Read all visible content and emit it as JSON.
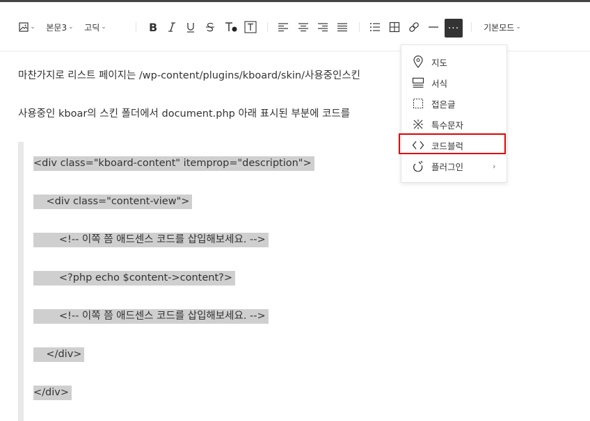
{
  "toolbar": {
    "text_style": "본문3",
    "font": "고딕",
    "mode": "기본모드",
    "more_label": "···",
    "buttons": [
      "image",
      "bold",
      "italic",
      "underline",
      "strikethrough",
      "text-color",
      "text-background",
      "align-left",
      "align-center",
      "align-right",
      "align-justify",
      "bullet-list",
      "table",
      "link",
      "horizontal-line",
      "more"
    ]
  },
  "content": {
    "para1": "마찬가지로 리스트 페이지는 /wp-content/plugins/kboard/skin/사용중인스킨",
    "para2": "사용중인 kboar의 스킨 폴더에서 document.php 아래 표시된 부분에 코드를",
    "code_lines": [
      "<div class=\"kboard-content\" itemprop=\"description\">",
      "    <div class=\"content-view\">",
      "        <!-- 이쪽 쯤 애드센스 코드를 삽입해보세요. -->",
      "        <?php echo $content->content?>",
      "        <!-- 이쪽 쯤 애드센스 코드를 삽입해보세요. -->",
      "    </div>",
      "</div>"
    ]
  },
  "menu": {
    "items": [
      {
        "label": "지도",
        "icon": "map-pin-icon"
      },
      {
        "label": "서식",
        "icon": "template-icon"
      },
      {
        "label": "접은글",
        "icon": "fold-icon"
      },
      {
        "label": "특수문자",
        "icon": "special-char-icon"
      },
      {
        "label": "코드블럭",
        "icon": "code-icon"
      },
      {
        "label": "플러그인",
        "icon": "plugin-icon"
      }
    ],
    "submenu_arrow": "›",
    "highlighted": "코드블럭",
    "highlight_color": "#e00000"
  }
}
